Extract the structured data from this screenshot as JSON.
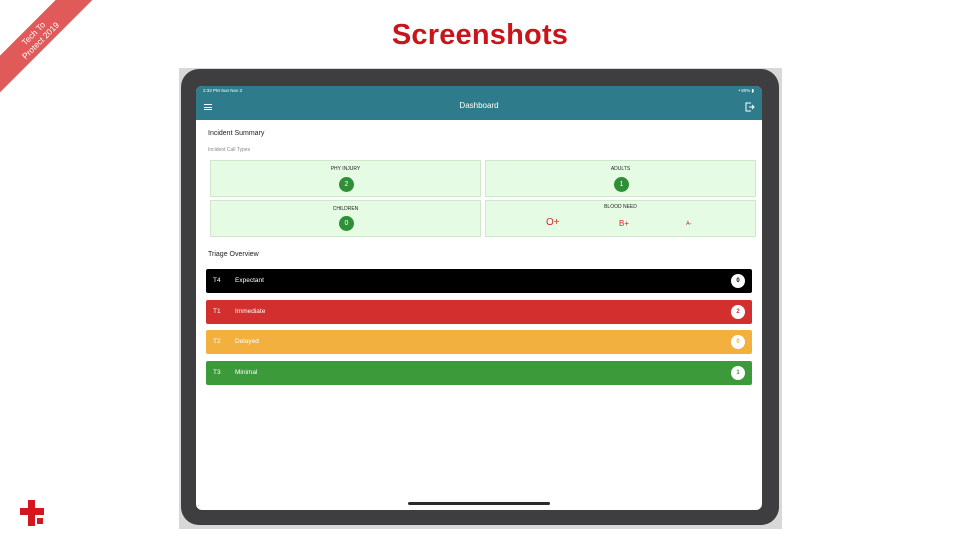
{
  "ribbon": {
    "line1": "Tech To",
    "line2": "Protect 2019"
  },
  "slide_title": "Screenshots",
  "status_bar": {
    "time": "2:33 PM  Sun Nov 3",
    "battery": "• 80% ▮"
  },
  "app_bar": {
    "title": "Dashboard"
  },
  "incident": {
    "title": "Incident Summary",
    "subtitle": "Incident Call Types",
    "cards": [
      {
        "label": "PHY INJURY",
        "value": "2"
      },
      {
        "label": "ADULTS",
        "value": "1"
      },
      {
        "label": "CHILDREN",
        "value": "0"
      },
      {
        "label": "BLOOD NEED",
        "types": [
          "O+",
          "B+",
          "A-"
        ]
      }
    ]
  },
  "triage": {
    "title": "Triage Overview",
    "rows": [
      {
        "code": "T4",
        "name": "Expectant",
        "count": "0",
        "color": "#000000",
        "count_color": "#000000"
      },
      {
        "code": "T1",
        "name": "Immediate",
        "count": "2",
        "color": "#d32f2f",
        "count_color": "#d32f2f"
      },
      {
        "code": "T2",
        "name": "Delayed",
        "count": "0",
        "color": "#f2b03f",
        "count_color": "#f2b03f"
      },
      {
        "code": "T3",
        "name": "Minimal",
        "count": "1",
        "color": "#3d9a3a",
        "count_color": "#3d9a3a"
      }
    ]
  },
  "colors": {
    "app_bar": "#2e7c8b",
    "title_red": "#c9141b",
    "card_bg": "#e6fbe4",
    "badge_green": "#2f8f37"
  }
}
